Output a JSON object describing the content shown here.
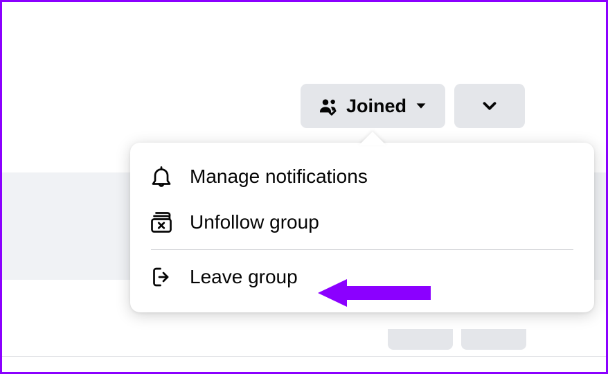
{
  "buttons": {
    "joined_label": "Joined"
  },
  "menu": {
    "manage_notifications": "Manage notifications",
    "unfollow_group": "Unfollow group",
    "leave_group": "Leave group"
  },
  "colors": {
    "accent_arrow": "#8b00ff",
    "button_bg": "#e4e6ea",
    "text": "#050505"
  }
}
